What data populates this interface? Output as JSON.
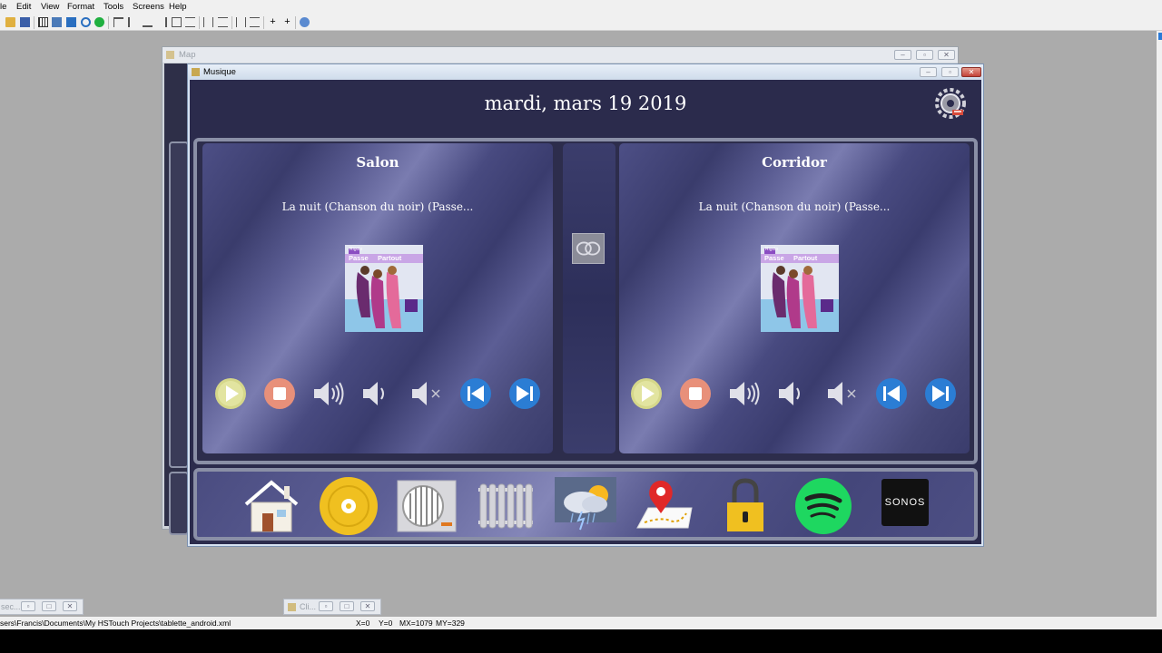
{
  "menu": [
    "le",
    "Edit",
    "View",
    "Format",
    "Tools",
    "Screens",
    "Help"
  ],
  "map_window": {
    "title": "Map"
  },
  "musique_window": {
    "title": "Musique"
  },
  "date": "mardi, mars 19 2019",
  "zones": [
    {
      "name": "Salon",
      "song": "La nuit (Chanson du noir) (Passe...",
      "album": {
        "badge": "Rigolo",
        "line1": "Passe",
        "line2": "Partout"
      }
    },
    {
      "name": "Corridor",
      "song": "La nuit (Chanson du noir) (Passe...",
      "album": {
        "badge": "Rigolo",
        "line1": "Passe",
        "line2": "Partout"
      }
    }
  ],
  "controls": [
    "play-icon",
    "stop-icon",
    "volume-up-icon",
    "volume-down-icon",
    "mute-icon",
    "previous-track-icon",
    "next-track-icon"
  ],
  "nav_icons": [
    "home-icon",
    "music-disc-icon",
    "fan-icon",
    "radiator-icon",
    "weather-icon",
    "map-location-icon",
    "lock-icon",
    "spotify-icon",
    "sonos-icon"
  ],
  "sonos_label": "SONOS",
  "bottom_windows": [
    {
      "title": "sec..."
    },
    {
      "title": "Cli..."
    }
  ],
  "status": {
    "path": "sers\\Francis\\Documents\\My HSTouch Projects\\tablette_android.xml",
    "x": "X=0",
    "y": "Y=0",
    "mx": "MX=1079",
    "my": "MY=329"
  },
  "colors": {
    "play": "#d5d78a",
    "stop": "#e8907a",
    "skip": "#2b7dd4",
    "spotify": "#1ed760",
    "disc": "#f0c020",
    "lock": "#f0c020"
  }
}
